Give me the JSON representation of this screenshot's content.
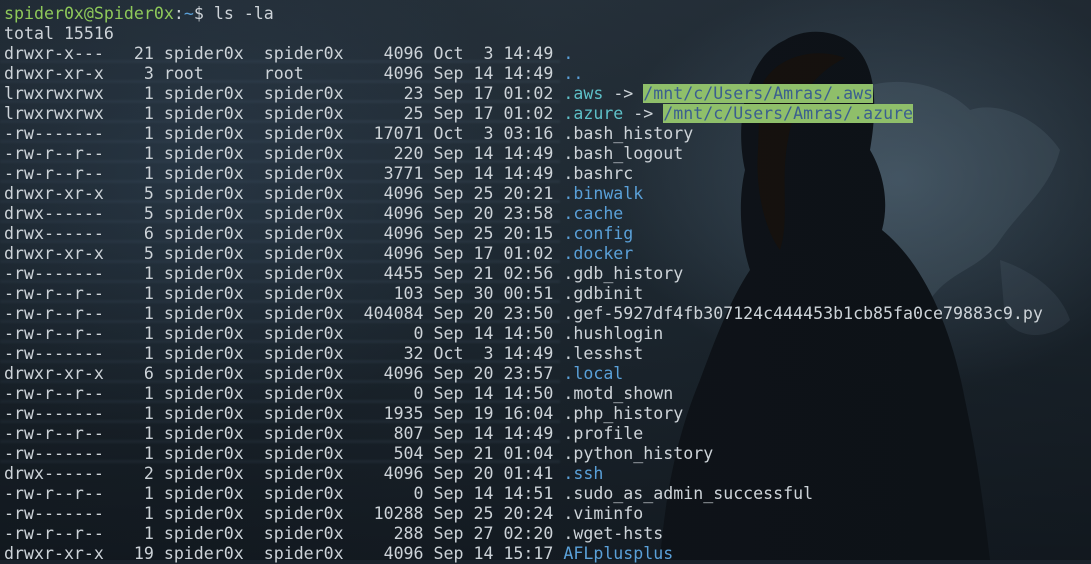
{
  "prompt": {
    "user_host": "spider0x@Spider0x",
    "separator": ":",
    "path": "~",
    "symbol": "$",
    "command": "ls -la"
  },
  "total_line": "total 15516",
  "entries": [
    {
      "perm": "drwxr-x---",
      "links": "21",
      "owner": "spider0x",
      "group": "spider0x",
      "size": "4096",
      "month": "Oct",
      "day": "3",
      "time": "14:49",
      "name": ".",
      "type": "dir"
    },
    {
      "perm": "drwxr-xr-x",
      "links": "3",
      "owner": "root",
      "group": "root",
      "size": "4096",
      "month": "Sep",
      "day": "14",
      "time": "14:49",
      "name": "..",
      "type": "dir"
    },
    {
      "perm": "lrwxrwxrwx",
      "links": "1",
      "owner": "spider0x",
      "group": "spider0x",
      "size": "23",
      "month": "Sep",
      "day": "17",
      "time": "01:02",
      "name": ".aws",
      "type": "link",
      "target": "/mnt/c/Users/Amras/.aws"
    },
    {
      "perm": "lrwxrwxrwx",
      "links": "1",
      "owner": "spider0x",
      "group": "spider0x",
      "size": "25",
      "month": "Sep",
      "day": "17",
      "time": "01:02",
      "name": ".azure",
      "type": "link",
      "target": "/mnt/c/Users/Amras/.azure"
    },
    {
      "perm": "-rw-------",
      "links": "1",
      "owner": "spider0x",
      "group": "spider0x",
      "size": "17071",
      "month": "Oct",
      "day": "3",
      "time": "03:16",
      "name": ".bash_history",
      "type": "file"
    },
    {
      "perm": "-rw-r--r--",
      "links": "1",
      "owner": "spider0x",
      "group": "spider0x",
      "size": "220",
      "month": "Sep",
      "day": "14",
      "time": "14:49",
      "name": ".bash_logout",
      "type": "file"
    },
    {
      "perm": "-rw-r--r--",
      "links": "1",
      "owner": "spider0x",
      "group": "spider0x",
      "size": "3771",
      "month": "Sep",
      "day": "14",
      "time": "14:49",
      "name": ".bashrc",
      "type": "file"
    },
    {
      "perm": "drwxr-xr-x",
      "links": "5",
      "owner": "spider0x",
      "group": "spider0x",
      "size": "4096",
      "month": "Sep",
      "day": "25",
      "time": "20:21",
      "name": ".binwalk",
      "type": "dir"
    },
    {
      "perm": "drwx------",
      "links": "5",
      "owner": "spider0x",
      "group": "spider0x",
      "size": "4096",
      "month": "Sep",
      "day": "20",
      "time": "23:58",
      "name": ".cache",
      "type": "dir"
    },
    {
      "perm": "drwx------",
      "links": "6",
      "owner": "spider0x",
      "group": "spider0x",
      "size": "4096",
      "month": "Sep",
      "day": "25",
      "time": "20:15",
      "name": ".config",
      "type": "dir"
    },
    {
      "perm": "drwxr-xr-x",
      "links": "5",
      "owner": "spider0x",
      "group": "spider0x",
      "size": "4096",
      "month": "Sep",
      "day": "17",
      "time": "01:02",
      "name": ".docker",
      "type": "dir"
    },
    {
      "perm": "-rw-------",
      "links": "1",
      "owner": "spider0x",
      "group": "spider0x",
      "size": "4455",
      "month": "Sep",
      "day": "21",
      "time": "02:56",
      "name": ".gdb_history",
      "type": "file"
    },
    {
      "perm": "-rw-r--r--",
      "links": "1",
      "owner": "spider0x",
      "group": "spider0x",
      "size": "103",
      "month": "Sep",
      "day": "30",
      "time": "00:51",
      "name": ".gdbinit",
      "type": "file"
    },
    {
      "perm": "-rw-r--r--",
      "links": "1",
      "owner": "spider0x",
      "group": "spider0x",
      "size": "404084",
      "month": "Sep",
      "day": "20",
      "time": "23:50",
      "name": ".gef-5927df4fb307124c444453b1cb85fa0ce79883c9.py",
      "type": "file"
    },
    {
      "perm": "-rw-r--r--",
      "links": "1",
      "owner": "spider0x",
      "group": "spider0x",
      "size": "0",
      "month": "Sep",
      "day": "14",
      "time": "14:50",
      "name": ".hushlogin",
      "type": "file"
    },
    {
      "perm": "-rw-------",
      "links": "1",
      "owner": "spider0x",
      "group": "spider0x",
      "size": "32",
      "month": "Oct",
      "day": "3",
      "time": "14:49",
      "name": ".lesshst",
      "type": "file"
    },
    {
      "perm": "drwxr-xr-x",
      "links": "6",
      "owner": "spider0x",
      "group": "spider0x",
      "size": "4096",
      "month": "Sep",
      "day": "20",
      "time": "23:57",
      "name": ".local",
      "type": "dir"
    },
    {
      "perm": "-rw-r--r--",
      "links": "1",
      "owner": "spider0x",
      "group": "spider0x",
      "size": "0",
      "month": "Sep",
      "day": "14",
      "time": "14:50",
      "name": ".motd_shown",
      "type": "file"
    },
    {
      "perm": "-rw-------",
      "links": "1",
      "owner": "spider0x",
      "group": "spider0x",
      "size": "1935",
      "month": "Sep",
      "day": "19",
      "time": "16:04",
      "name": ".php_history",
      "type": "file"
    },
    {
      "perm": "-rw-r--r--",
      "links": "1",
      "owner": "spider0x",
      "group": "spider0x",
      "size": "807",
      "month": "Sep",
      "day": "14",
      "time": "14:49",
      "name": ".profile",
      "type": "file"
    },
    {
      "perm": "-rw-------",
      "links": "1",
      "owner": "spider0x",
      "group": "spider0x",
      "size": "504",
      "month": "Sep",
      "day": "21",
      "time": "01:04",
      "name": ".python_history",
      "type": "file"
    },
    {
      "perm": "drwx------",
      "links": "2",
      "owner": "spider0x",
      "group": "spider0x",
      "size": "4096",
      "month": "Sep",
      "day": "20",
      "time": "01:41",
      "name": ".ssh",
      "type": "dir"
    },
    {
      "perm": "-rw-r--r--",
      "links": "1",
      "owner": "spider0x",
      "group": "spider0x",
      "size": "0",
      "month": "Sep",
      "day": "14",
      "time": "14:51",
      "name": ".sudo_as_admin_successful",
      "type": "file"
    },
    {
      "perm": "-rw-------",
      "links": "1",
      "owner": "spider0x",
      "group": "spider0x",
      "size": "10288",
      "month": "Sep",
      "day": "25",
      "time": "20:24",
      "name": ".viminfo",
      "type": "file"
    },
    {
      "perm": "-rw-r--r--",
      "links": "1",
      "owner": "spider0x",
      "group": "spider0x",
      "size": "288",
      "month": "Sep",
      "day": "27",
      "time": "02:20",
      "name": ".wget-hsts",
      "type": "file"
    },
    {
      "perm": "drwxr-xr-x",
      "links": "19",
      "owner": "spider0x",
      "group": "spider0x",
      "size": "4096",
      "month": "Sep",
      "day": "14",
      "time": "15:17",
      "name": "AFLplusplus",
      "type": "dir"
    }
  ],
  "colors": {
    "prompt_user": "#8ec95a",
    "prompt_path": "#5aa0d8",
    "directory": "#5aa0d8",
    "symlink": "#5ec0c8",
    "link_target_bg": "#8fbf6a",
    "text": "#cdd3d8"
  }
}
